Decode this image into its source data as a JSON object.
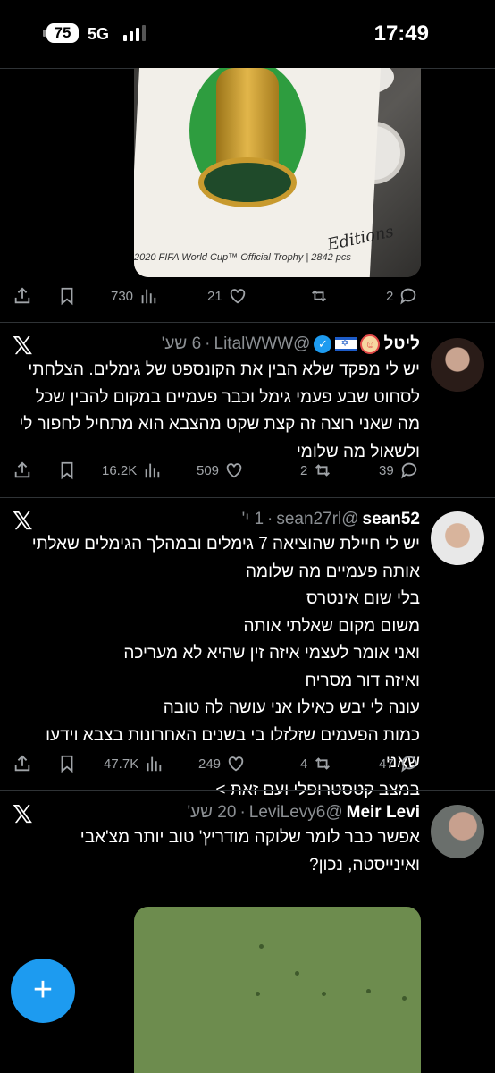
{
  "status_bar": {
    "battery": "75",
    "network": "5G",
    "time": "17:49"
  },
  "tweet0": {
    "image_caption": "2020 FIFA World Cup™ Official Trophy | 2842 pcs",
    "image_brand": "Editions",
    "stats": {
      "views": "730",
      "likes": "21",
      "retweets": "",
      "replies": "2"
    }
  },
  "tweet1": {
    "name": "ליטל",
    "handle": "@LitalWWW",
    "dot": "·",
    "time": "6 שע'",
    "lines": [
      "יש לי מפקד שלא הבין את הקונספט של גימלים. הצלחתי",
      "לסחוט שבע פעמי גימל וכבר פעמיים במקום להבין שכל",
      "מה שאני רוצה זה קצת שקט מהצבא הוא מתחיל לחפור לי",
      "ולשאול מה שלומי"
    ],
    "stats": {
      "views": "16.2K",
      "likes": "509",
      "retweets": "2",
      "replies": "39"
    }
  },
  "tweet2": {
    "name": "sean52",
    "handle": "@sean27rl",
    "dot": "·",
    "time": "1 י'",
    "lines": [
      "יש לי חיילת שהוציאה 7 גימלים ובמהלך הגימלים שאלתי",
      "אותה פעמיים מה שלומה",
      "בלי שום אינטרס",
      "משום מקום שאלתי אותה",
      "ואני אומר לעצמי איזה זין שהיא לא מעריכה",
      "ואיזה דור מסריח",
      "עונה לי יבש כאילו אני עושה לה טובה",
      "כמות הפעמים שזלזלו בי בשנים האחרונות בצבא וידעו שאני",
      "במצב קטסטרופלי ועם זאת >"
    ],
    "stats": {
      "views": "47.7K",
      "likes": "249",
      "retweets": "4",
      "replies": "47"
    }
  },
  "tweet3": {
    "name": "Meir Levi",
    "handle": "@LeviLevy6",
    "dot": "·",
    "time": "20 שע'",
    "lines": [
      "אפשר כבר לומר שלוקה מודריץ' טוב יותר מצ'אבי",
      "ואינייסטה, נכון?"
    ]
  },
  "fab": {
    "label": "+"
  },
  "colors": {
    "accent": "#1d9bf0",
    "background": "#000000",
    "muted": "#8b8f93"
  }
}
